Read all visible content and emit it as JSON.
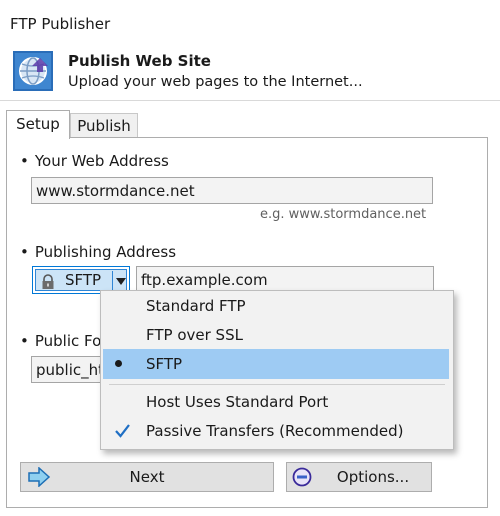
{
  "window": {
    "title": "FTP Publisher"
  },
  "header": {
    "title": "Publish Web Site",
    "subtitle": "Upload your web pages to the Internet..."
  },
  "tabs": [
    {
      "label": "Setup",
      "active": true
    },
    {
      "label": "Publish",
      "active": false
    }
  ],
  "web_address": {
    "label": "Your Web Address",
    "value": "www.stormdance.net",
    "hint": "e.g. www.stormdance.net"
  },
  "publishing_address": {
    "label": "Publishing Address",
    "protocol": "SFTP",
    "host": "ftp.example.com"
  },
  "public_folder": {
    "label": "Public Fol",
    "value": "public_ht"
  },
  "protocol_menu": {
    "items": [
      {
        "label": "Standard FTP"
      },
      {
        "label": "FTP over SSL"
      },
      {
        "label": "SFTP",
        "selected": true
      },
      {
        "label": "Host Uses Standard Port"
      },
      {
        "label": "Passive Transfers (Recommended)",
        "checked": true
      }
    ]
  },
  "buttons": {
    "next": "Next",
    "options": "Options..."
  },
  "colors": {
    "accent": "#0078d7",
    "selection": "#9ecbf3"
  }
}
